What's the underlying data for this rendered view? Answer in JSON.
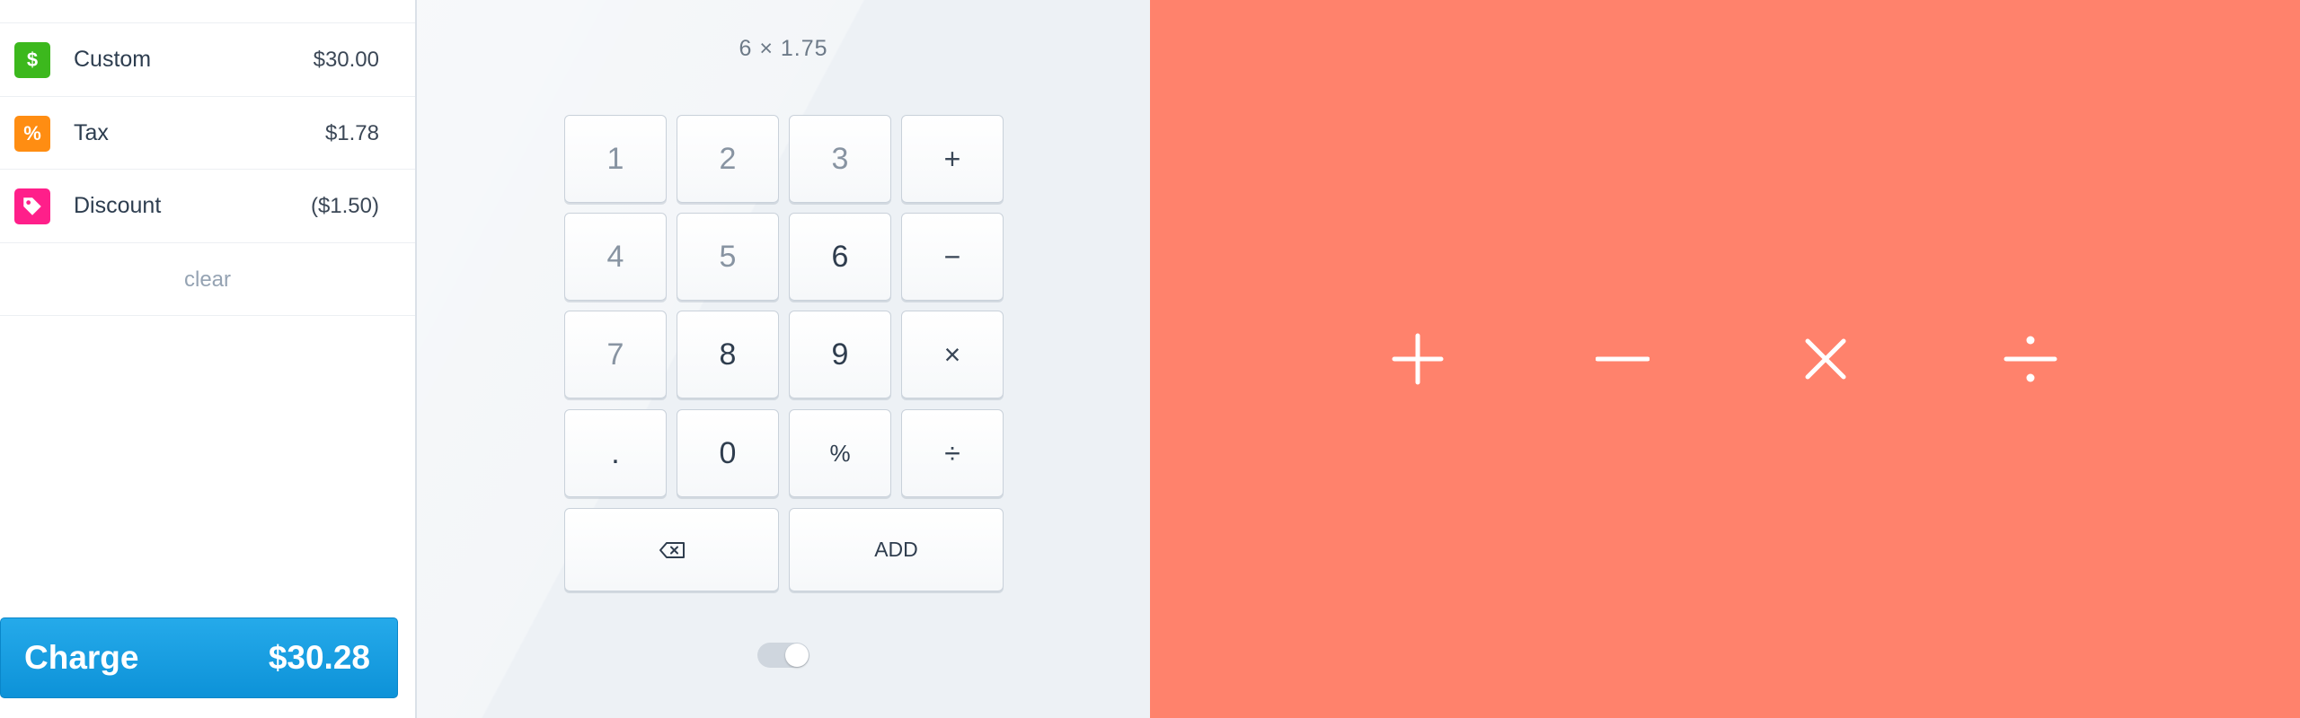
{
  "order": {
    "items": [
      {
        "name": "Custom",
        "amount": "$30.00",
        "icon": "dollar-icon",
        "color": "#3cb81d"
      },
      {
        "name": "Tax",
        "amount": "$1.78",
        "icon": "percent-icon",
        "color": "#ff8d12"
      },
      {
        "name": "Discount",
        "amount": "($1.50)",
        "icon": "tag-icon",
        "color": "#ff1f8a"
      }
    ],
    "clear_label": "clear",
    "charge_label": "Charge",
    "charge_total": "$30.28"
  },
  "keypad": {
    "expression": "6 × 1.75",
    "keys": [
      "1",
      "2",
      "3",
      "+",
      "4",
      "5",
      "6",
      "−",
      "7",
      "8",
      "9",
      "×",
      ".",
      "0",
      "%",
      "÷"
    ],
    "backspace_icon": "backspace-icon",
    "add_label": "ADD",
    "toggle_on": true
  },
  "operators": {
    "symbols": [
      "+",
      "−",
      "×",
      "÷"
    ],
    "color": "#ffffff",
    "background": "#ff826c"
  }
}
